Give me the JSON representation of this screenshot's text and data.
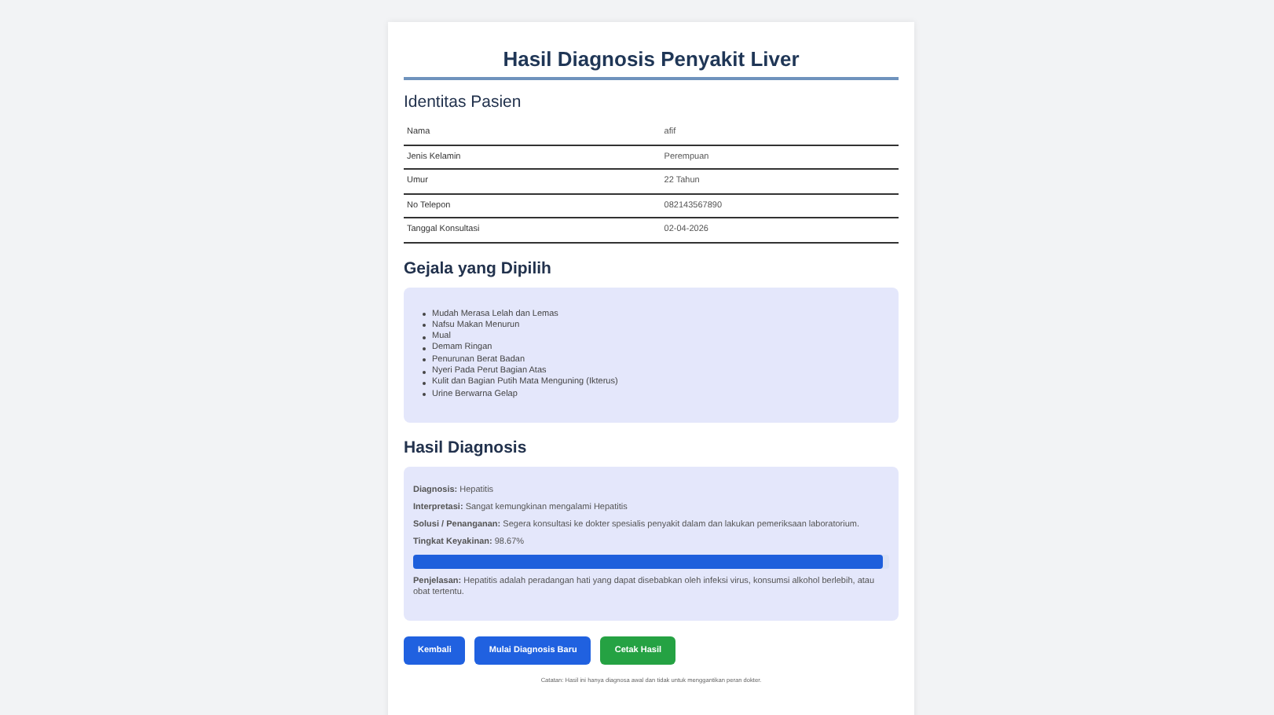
{
  "title": "Hasil Diagnosis Penyakit Liver",
  "identity": {
    "heading": "Identitas Pasien",
    "rows": [
      {
        "label": "Nama",
        "value": "afif"
      },
      {
        "label": "Jenis Kelamin",
        "value": "Perempuan"
      },
      {
        "label": "Umur",
        "value": "22 Tahun"
      },
      {
        "label": "No Telepon",
        "value": "082143567890"
      },
      {
        "label": "Tanggal Konsultasi",
        "value": "02-04-2026"
      }
    ]
  },
  "symptoms": {
    "heading": "Gejala yang Dipilih",
    "items": [
      "Mudah Merasa Lelah dan Lemas",
      "Nafsu Makan Menurun",
      "Mual",
      "Demam Ringan",
      "Penurunan Berat Badan",
      "Nyeri Pada Perut Bagian Atas",
      "Kulit dan Bagian Putih Mata Menguning (Ikterus)",
      "Urine Berwarna Gelap"
    ]
  },
  "result": {
    "heading": "Hasil Diagnosis",
    "lines": [
      "**Diagnosis:** Hepatitis",
      "**Interpretasi:** Sangat kemungkinan mengalami Hepatitis",
      "**Solusi / Penanganan:** Segera konsultasi ke dokter spesialis penyakit dalam dan lakukan pemeriksaan laboratorium.",
      "**Tingkat Keyakinan:** 98.67%"
    ],
    "level": 0.9867,
    "explanation": "**Penjelasan:** Hepatitis adalah peradangan hati yang dapat disebabkan oleh infeksi virus, konsumsi alkohol berlebih, atau obat tertentu."
  },
  "buttons": [
    {
      "label": "Kembali",
      "kind": "primary"
    },
    {
      "label": "Mulai Diagnosis Baru",
      "kind": "primary"
    },
    {
      "label": "Cetak Hasil",
      "kind": "success"
    }
  ],
  "footnote": "Catatan: Hasil ini hanya diagnosa awal dan tidak untuk menggantikan peran dokter."
}
